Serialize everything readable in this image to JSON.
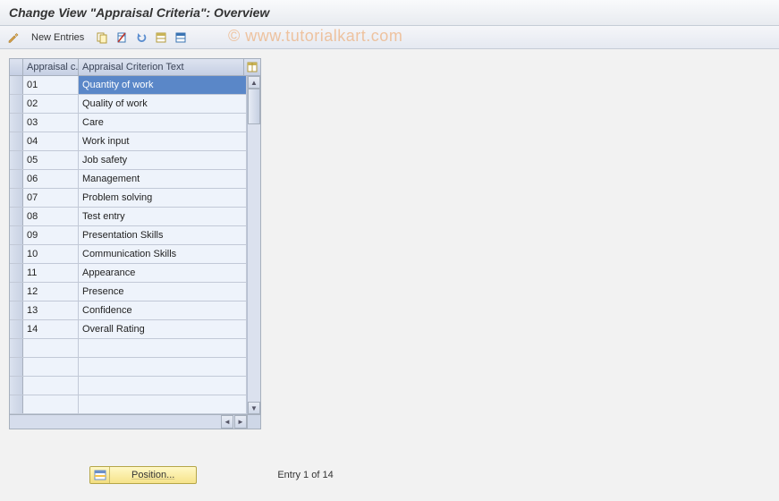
{
  "title": "Change View \"Appraisal Criteria\": Overview",
  "watermark": "© www.tutorialkart.com",
  "toolbar": {
    "new_entries": "New Entries"
  },
  "grid": {
    "headers": {
      "c1": "Appraisal c...",
      "c2": "Appraisal Criterion Text"
    },
    "rows": [
      {
        "code": "01",
        "text": "Quantity of work",
        "selected": true
      },
      {
        "code": "02",
        "text": "Quality of work"
      },
      {
        "code": "03",
        "text": "Care"
      },
      {
        "code": "04",
        "text": "Work input"
      },
      {
        "code": "05",
        "text": "Job safety"
      },
      {
        "code": "06",
        "text": "Management"
      },
      {
        "code": "07",
        "text": "Problem solving"
      },
      {
        "code": "08",
        "text": "Test entry"
      },
      {
        "code": "09",
        "text": "Presentation Skills"
      },
      {
        "code": "10",
        "text": "Communication Skills"
      },
      {
        "code": "11",
        "text": "Appearance"
      },
      {
        "code": "12",
        "text": "Presence"
      },
      {
        "code": "13",
        "text": "Confidence"
      },
      {
        "code": "14",
        "text": "Overall Rating"
      },
      {
        "code": "",
        "text": ""
      },
      {
        "code": "",
        "text": ""
      },
      {
        "code": "",
        "text": ""
      },
      {
        "code": "",
        "text": ""
      }
    ]
  },
  "footer": {
    "position_label": "Position...",
    "entry_text": "Entry 1 of 14"
  }
}
